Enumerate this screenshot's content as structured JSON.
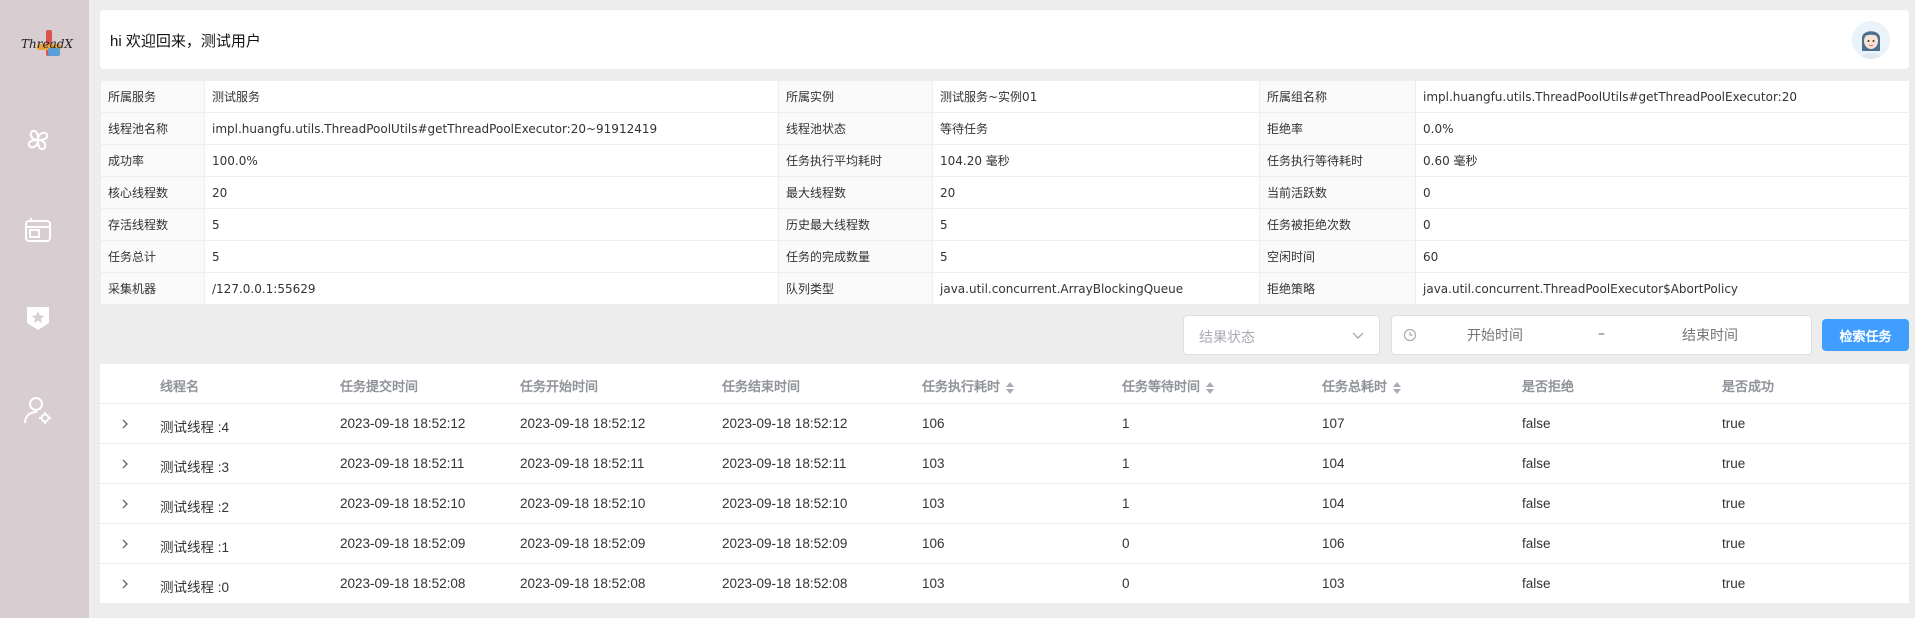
{
  "sidebar": {
    "logo_text": "ThreadX",
    "items": [
      {
        "icon": "clover-icon"
      },
      {
        "icon": "window-icon"
      },
      {
        "icon": "star-shield-icon"
      },
      {
        "icon": "user-settings-icon"
      }
    ]
  },
  "header": {
    "greeting": "hi 欢迎回来，测试用户",
    "avatar": "avatar-icon"
  },
  "info": {
    "rows": [
      [
        {
          "k": "所属服务",
          "v": "测试服务"
        },
        {
          "k": "所属实例",
          "v": "测试服务~实例01"
        },
        {
          "k": "所属组名称",
          "v": "impl.huangfu.utils.ThreadPoolUtils#getThreadPoolExecutor:20"
        }
      ],
      [
        {
          "k": "线程池名称",
          "v": "impl.huangfu.utils.ThreadPoolUtils#getThreadPoolExecutor:20~91912419"
        },
        {
          "k": "线程池状态",
          "v": "等待任务"
        },
        {
          "k": "拒绝率",
          "v": "0.0%"
        }
      ],
      [
        {
          "k": "成功率",
          "v": "100.0%"
        },
        {
          "k": "任务执行平均耗时",
          "v": "104.20 毫秒"
        },
        {
          "k": "任务执行等待耗时",
          "v": "0.60 毫秒"
        }
      ],
      [
        {
          "k": "核心线程数",
          "v": "20"
        },
        {
          "k": "最大线程数",
          "v": "20"
        },
        {
          "k": "当前活跃数",
          "v": "0"
        }
      ],
      [
        {
          "k": "存活线程数",
          "v": "5"
        },
        {
          "k": "历史最大线程数",
          "v": "5"
        },
        {
          "k": "任务被拒绝次数",
          "v": "0"
        }
      ],
      [
        {
          "k": "任务总计",
          "v": "5"
        },
        {
          "k": "任务的完成数量",
          "v": "5"
        },
        {
          "k": "空闲时间",
          "v": "60"
        }
      ],
      [
        {
          "k": "采集机器",
          "v": "/127.0.0.1:55629"
        },
        {
          "k": "队列类型",
          "v": "java.util.concurrent.ArrayBlockingQueue"
        },
        {
          "k": "拒绝策略",
          "v": "java.util.concurrent.ThreadPoolExecutor$AbortPolicy"
        }
      ]
    ]
  },
  "filters": {
    "status_placeholder": "结果状态",
    "start_placeholder": "开始时间",
    "separator": "–",
    "end_placeholder": "结束时间",
    "search_label": "检索任务"
  },
  "table": {
    "headers": [
      "线程名",
      "任务提交时间",
      "任务开始时间",
      "任务结束时间",
      "任务执行耗时",
      "任务等待时间",
      "任务总耗时",
      "是否拒绝",
      "是否成功"
    ],
    "rows": [
      [
        "测试线程 :4",
        "2023-09-18 18:52:12",
        "2023-09-18 18:52:12",
        "2023-09-18 18:52:12",
        "106",
        "1",
        "107",
        "false",
        "true"
      ],
      [
        "测试线程 :3",
        "2023-09-18 18:52:11",
        "2023-09-18 18:52:11",
        "2023-09-18 18:52:11",
        "103",
        "1",
        "104",
        "false",
        "true"
      ],
      [
        "测试线程 :2",
        "2023-09-18 18:52:10",
        "2023-09-18 18:52:10",
        "2023-09-18 18:52:10",
        "103",
        "1",
        "104",
        "false",
        "true"
      ],
      [
        "测试线程 :1",
        "2023-09-18 18:52:09",
        "2023-09-18 18:52:09",
        "2023-09-18 18:52:09",
        "106",
        "0",
        "106",
        "false",
        "true"
      ],
      [
        "测试线程 :0",
        "2023-09-18 18:52:08",
        "2023-09-18 18:52:08",
        "2023-09-18 18:52:08",
        "103",
        "0",
        "103",
        "false",
        "true"
      ]
    ]
  },
  "colors": {
    "sidebar_bg": "#d8cdd0",
    "page_bg": "#eeedee",
    "primary": "#409eff"
  }
}
